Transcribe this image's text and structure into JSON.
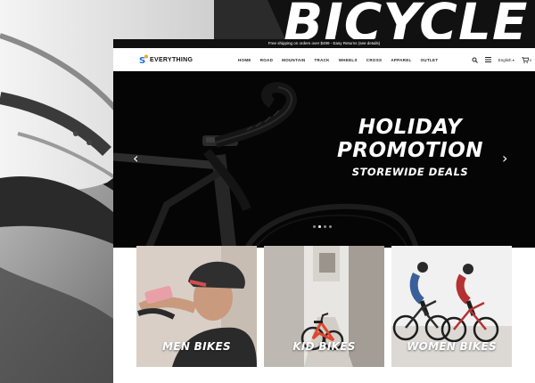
{
  "background": {
    "title": "BICYCLE"
  },
  "site": {
    "announcement": "Free shipping on orders over $499 - Easy Returns (see details)",
    "brand": {
      "name": "EVERYTHING",
      "logo_letter": "S"
    },
    "nav": [
      "HOME",
      "ROAD",
      "MOUNTAIN",
      "TRACK",
      "WHEELS",
      "CROSS",
      "APPAREL",
      "OUTLET"
    ],
    "tools": {
      "search_icon": "search-icon",
      "menu_icon": "menu-icon",
      "language": "English",
      "cart_count": "0"
    },
    "hero": {
      "line1": "HOLIDAY",
      "line2": "PROMOTION",
      "subtitle": "STOREWIDE DEALS",
      "prev_arrow": "‹",
      "next_arrow": "›",
      "slide_count": 4,
      "active_slide": 2
    },
    "categories": [
      {
        "label": "MEN BIKES"
      },
      {
        "label": "KID BIKES"
      },
      {
        "label": "WOMEN BIKES"
      }
    ]
  },
  "colors": {
    "accent_blue": "#1e6fd9",
    "accent_orange": "#f2a51a",
    "dark": "#050505"
  }
}
